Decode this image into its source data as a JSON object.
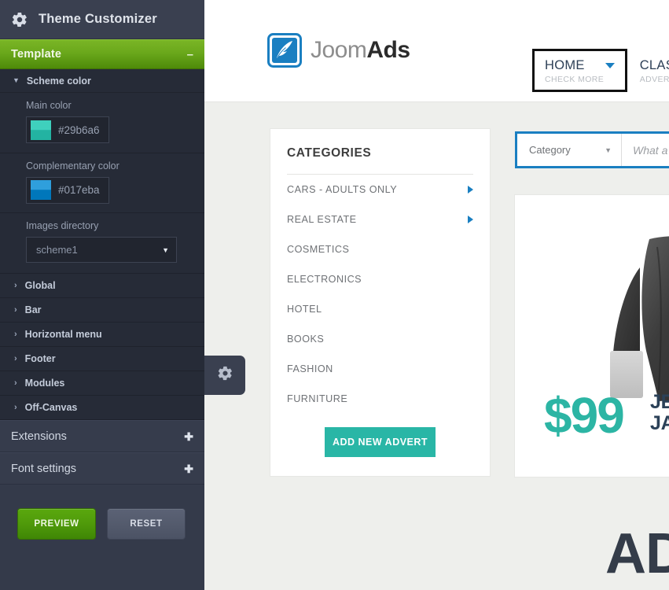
{
  "customizer": {
    "header_title": "Theme Customizer",
    "header_icon": "gear-icon",
    "template": {
      "label": "Template",
      "toggle_sign": "–"
    },
    "scheme_color": {
      "label": "Scheme color",
      "chevron": "⌄"
    },
    "fields": {
      "main_color": {
        "label": "Main color",
        "value": "#29b6a6"
      },
      "complementary_color": {
        "label": "Complementary color",
        "value": "#017eba"
      },
      "images_directory": {
        "label": "Images directory",
        "value": "scheme1",
        "caret": "▼"
      }
    },
    "sections": [
      {
        "label": "Global",
        "chevron": "›"
      },
      {
        "label": "Bar",
        "chevron": "›"
      },
      {
        "label": "Horizontal menu",
        "chevron": "›"
      },
      {
        "label": "Footer",
        "chevron": "›"
      },
      {
        "label": "Modules",
        "chevron": "›"
      },
      {
        "label": "Off-Canvas",
        "chevron": "›"
      }
    ],
    "groups": [
      {
        "label": "Extensions",
        "sign": "✚"
      },
      {
        "label": "Font settings",
        "sign": "✚"
      }
    ],
    "actions": {
      "preview": "PREVIEW",
      "reset": "RESET"
    },
    "tab_handle_icon": "gear-icon"
  },
  "site": {
    "logo": {
      "text_light": "Joom",
      "text_bold": "Ads",
      "icon": "quill-pen-icon"
    },
    "nav": [
      {
        "main": "HOME",
        "sub": "CHECK MORE",
        "caret": "▼",
        "selected": true
      },
      {
        "main": "CLASS",
        "sub": "ADVERTS",
        "selected": false
      }
    ],
    "categories_card": {
      "title": "CATEGORIES",
      "items": [
        {
          "label": "CARS - ADULTS ONLY",
          "has_arrow": true
        },
        {
          "label": "REAL ESTATE",
          "has_arrow": true
        },
        {
          "label": "COSMETICS",
          "has_arrow": false
        },
        {
          "label": "ELECTRONICS",
          "has_arrow": false
        },
        {
          "label": "HOTEL",
          "has_arrow": false
        },
        {
          "label": "BOOKS",
          "has_arrow": false
        },
        {
          "label": "FASHION",
          "has_arrow": false
        },
        {
          "label": "FURNITURE",
          "has_arrow": false
        }
      ],
      "button": "ADD NEW ADVERT"
    },
    "search": {
      "category_value": "Category",
      "category_caret": "▼",
      "query_placeholder": "What a"
    },
    "promo": {
      "price": "$99",
      "line1": "JE",
      "line2": "JA"
    },
    "bottom_heading": "AD"
  },
  "colors": {
    "accent_teal": "#29b6a6",
    "accent_blue": "#017eba",
    "sidebar_bg": "#343a4a",
    "template_green": "#5aa80e"
  }
}
